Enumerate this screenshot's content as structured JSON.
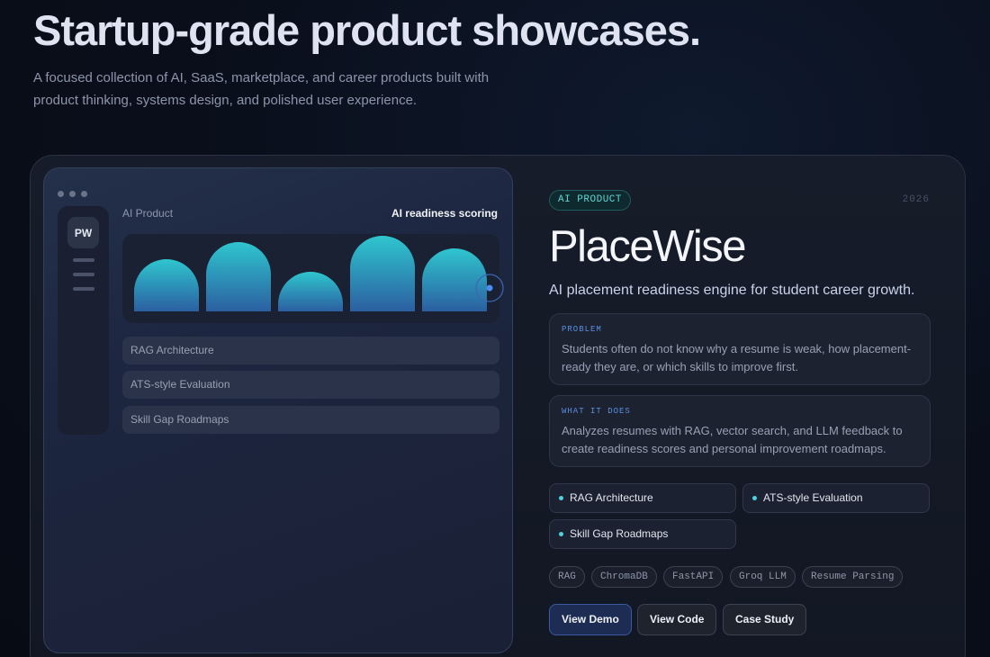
{
  "hero": {
    "title": "Startup-grade product showcases.",
    "subtitle": "A focused collection of AI, SaaS, marketplace, and career products built with product thinking, systems design, and polished user experience."
  },
  "mockup": {
    "logo": "PW",
    "category": "AI Product",
    "heading": "AI readiness scoring",
    "rows": [
      "RAG Architecture",
      "ATS-style Evaluation",
      "Skill Gap Roadmaps"
    ]
  },
  "product": {
    "badge": "AI PRODUCT",
    "year": "2026",
    "name": "PlaceWise",
    "tagline": "AI placement readiness engine for student career growth.",
    "problem_label": "PROBLEM",
    "problem_text": "Students often do not know why a resume is weak, how placement-ready they are, or which skills to improve first.",
    "does_label": "WHAT IT DOES",
    "does_text": "Analyzes resumes with RAG, vector search, and LLM feedback to create readiness scores and personal improvement roadmaps.",
    "features": [
      "RAG Architecture",
      "ATS-style Evaluation",
      "Skill Gap Roadmaps"
    ],
    "tags": [
      "RAG",
      "ChromaDB",
      "FastAPI",
      "Groq LLM",
      "Resume Parsing"
    ],
    "buttons": {
      "demo": "View Demo",
      "code": "View Code",
      "case": "Case Study"
    }
  },
  "colors": {
    "accent": "#4fd1e0",
    "primary_button": "#1d2c52",
    "label_blue": "#5b8fe0"
  }
}
